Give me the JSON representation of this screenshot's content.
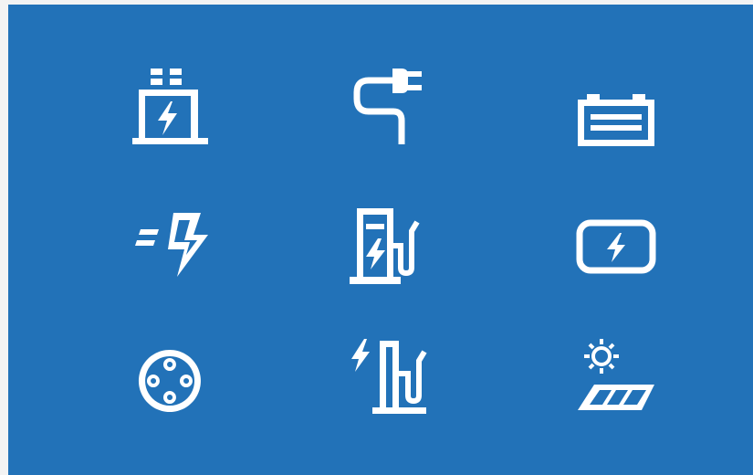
{
  "colors": {
    "page_background": "#f3f3f3",
    "panel_background": "#2272b8",
    "icon": "#ffffff"
  },
  "icons": [
    "battery-charger-icon",
    "power-plug-icon",
    "car-battery-icon",
    "fast-charge-bolt-icon",
    "ev-charging-station-icon",
    "phone-battery-charge-icon",
    "ev-charging-socket-icon",
    "charging-post-icon",
    "solar-panel-sun-icon"
  ]
}
